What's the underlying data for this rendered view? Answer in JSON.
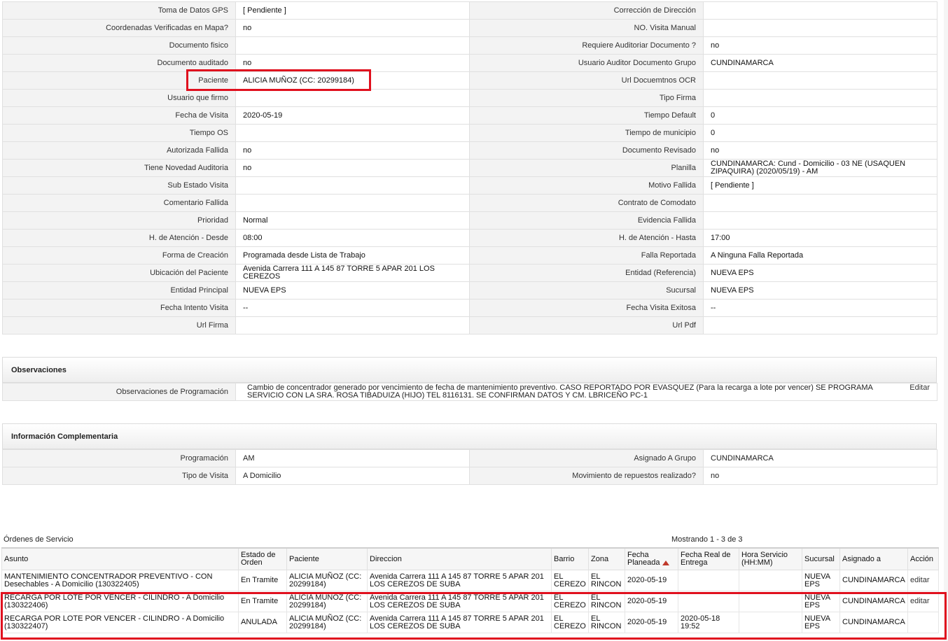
{
  "details": [
    {
      "l1": "Toma de Datos GPS",
      "v1": "[ Pendiente ]",
      "l2": "Corrección de Dirección",
      "v2": ""
    },
    {
      "l1": "Coordenadas Verificadas en Mapa?",
      "v1": "no",
      "l2": "NO. Visita Manual",
      "v2": ""
    },
    {
      "l1": "Documento fisico",
      "v1": "",
      "l2": "Requiere Auditoriar Documento ?",
      "v2": "no"
    },
    {
      "l1": "Documento auditado",
      "v1": "no",
      "l2": "Usuario Auditor Documento Grupo",
      "v2": "CUNDINAMARCA"
    },
    {
      "l1": "Paciente",
      "v1": "ALICIA MUÑOZ (CC: 20299184)",
      "l2": "Url Docuemtnos OCR",
      "v2": ""
    },
    {
      "l1": "Usuario que firmo",
      "v1": "",
      "l2": "Tipo Firma",
      "v2": ""
    },
    {
      "l1": "Fecha de Visita",
      "v1": "2020-05-19",
      "l2": "Tiempo Default",
      "v2": "0"
    },
    {
      "l1": "Tiempo OS",
      "v1": "",
      "l2": "Tiempo de municipio",
      "v2": "0"
    },
    {
      "l1": "Autorizada Fallida",
      "v1": "no",
      "l2": "Documento Revisado",
      "v2": "no"
    },
    {
      "l1": "Tiene Novedad Auditoria",
      "v1": "no",
      "l2": "Planilla",
      "v2": "CUNDINAMARCA: Cund - Domicilio - 03 NE (USAQUEN ZIPAQUIRA) (2020/05/19) - AM"
    },
    {
      "l1": "Sub Estado Visita",
      "v1": "",
      "l2": "Motivo Fallida",
      "v2": "[ Pendiente ]"
    },
    {
      "l1": "Comentario Fallida",
      "v1": "",
      "l2": "Contrato de Comodato",
      "v2": ""
    },
    {
      "l1": "Prioridad",
      "v1": "Normal",
      "l2": "Evidencia Fallida",
      "v2": ""
    },
    {
      "l1": "H. de Atención - Desde",
      "v1": "08:00",
      "l2": "H. de Atención - Hasta",
      "v2": "17:00"
    },
    {
      "l1": "Forma de Creación",
      "v1": "Programada desde Lista de Trabajo",
      "l2": "Falla Reportada",
      "v2": "A Ninguna Falla Reportada"
    },
    {
      "l1": "Ubicación del Paciente",
      "v1": "Avenida Carrera 111 A 145 87 TORRE 5 APAR 201 LOS CEREZOS",
      "l2": "Entidad (Referencia)",
      "v2": "NUEVA EPS"
    },
    {
      "l1": "Entidad Principal",
      "v1": "NUEVA EPS",
      "l2": "Sucursal",
      "v2": "NUEVA EPS"
    },
    {
      "l1": "Fecha Intento Visita",
      "v1": "--",
      "l2": "Fecha Visita Exitosa",
      "v2": "--"
    },
    {
      "l1": "Url Firma",
      "v1": "",
      "l2": "Url Pdf",
      "v2": ""
    }
  ],
  "observaciones": {
    "title": "Observaciones",
    "label": "Observaciones de Programación",
    "text": "Cambio de concentrador generado por vencimiento de fecha de mantenimiento preventivo. CASO REPORTADO POR EVASQUEZ (Para la recarga a lote por vencer) SE PROGRAMA SERVICIO CON LA SRA. ROSA TIBADUIZA (HIJO) TEL 8116131. SE CONFIRMAN DATOS Y CM. LBRICEÑO PC-1",
    "edit": "Editar"
  },
  "info": {
    "title": "Información Complementaria",
    "rows": [
      {
        "l1": "Programación",
        "v1": "AM",
        "l2": "Asignado A Grupo",
        "v2": "CUNDINAMARCA"
      },
      {
        "l1": "Tipo de Visita",
        "v1": "A Domicilio",
        "l2": "Movimiento de repuestos realizado?",
        "v2": "no"
      }
    ]
  },
  "orders": {
    "title": "Órdenes de Servicio",
    "count": "Mostrando 1 - 3 de 3",
    "headers": [
      "Asunto",
      "Estado de Orden",
      "Paciente",
      "Direccion",
      "Barrio",
      "Zona",
      "Fecha Planeada",
      "Fecha Real de Entrega",
      "Hora Servicio (HH:MM)",
      "Sucursal",
      "Asignado a",
      "Acción"
    ],
    "rows": [
      [
        "MANTENIMIENTO CONCENTRADOR PREVENTIVO - CON Desechables - A Domicilio (130322405)",
        "En Tramite",
        "ALICIA MUÑOZ (CC: 20299184)",
        "Avenida Carrera 111 A 145 87 TORRE 5 APAR 201 LOS CEREZOS DE SUBA",
        "EL CEREZO",
        "EL RINCON",
        "2020-05-19",
        "",
        "",
        "NUEVA EPS",
        "CUNDINAMARCA",
        "editar"
      ],
      [
        "RECARGA POR LOTE POR VENCER - CILINDRO - A Domicilio (130322406)",
        "En Tramite",
        "ALICIA MUÑOZ (CC: 20299184)",
        "Avenida Carrera 111 A 145 87 TORRE 5 APAR 201 LOS CEREZOS DE SUBA",
        "EL CEREZO",
        "EL RINCON",
        "2020-05-19",
        "",
        "",
        "NUEVA EPS",
        "CUNDINAMARCA",
        "editar"
      ],
      [
        "RECARGA POR LOTE POR VENCER - CILINDRO - A Domicilio (130322407)",
        "ANULADA",
        "ALICIA MUÑOZ (CC: 20299184)",
        "Avenida Carrera 111 A 145 87 TORRE 5 APAR 201 LOS CEREZOS DE SUBA",
        "EL CEREZO",
        "EL RINCON",
        "2020-05-19",
        "2020-05-18 19:52",
        "",
        "NUEVA EPS",
        "CUNDINAMARCA",
        ""
      ]
    ]
  },
  "colors": {
    "highlight": "#e0101e",
    "sort_arrow": "#c0392b"
  }
}
